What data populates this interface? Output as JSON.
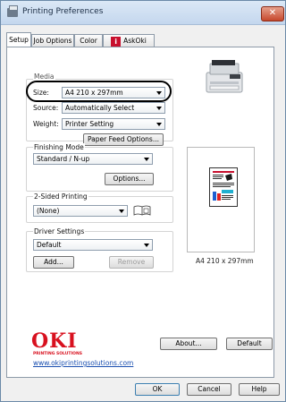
{
  "window": {
    "title": "Printing Preferences",
    "close_glyph": "✕"
  },
  "tabs": [
    {
      "label": "Setup"
    },
    {
      "label": "Job Options"
    },
    {
      "label": "Color"
    },
    {
      "label": "AskOki"
    }
  ],
  "tab_info_icon": "i",
  "media": {
    "group_label": "Media",
    "size_label": "Size:",
    "size_value": "A4 210 x 297mm",
    "source_label": "Source:",
    "source_value": "Automatically Select",
    "weight_label": "Weight:",
    "weight_value": "Printer Setting",
    "paper_feed_button": "Paper Feed Options..."
  },
  "finishing": {
    "label": "Finishing Mode",
    "value": "Standard / N-up",
    "options_button": "Options..."
  },
  "duplex": {
    "label": "2-Sided Printing",
    "value": "(None)"
  },
  "driver": {
    "label": "Driver Settings",
    "value": "Default",
    "add_button": "Add...",
    "remove_button": "Remove"
  },
  "preview": {
    "caption": "A4 210 x 297mm"
  },
  "branding": {
    "logo": "OKI",
    "tagline": "PRINTING SOLUTIONS",
    "url": "www.okiprintingsolutions.com"
  },
  "panel_buttons": {
    "about": "About...",
    "default": "Default"
  },
  "dialog_buttons": {
    "ok": "OK",
    "cancel": "Cancel",
    "help": "Help"
  },
  "colors": {
    "accent_red": "#d8111f",
    "link_blue": "#1a4fb0",
    "highlight": "#000000"
  }
}
